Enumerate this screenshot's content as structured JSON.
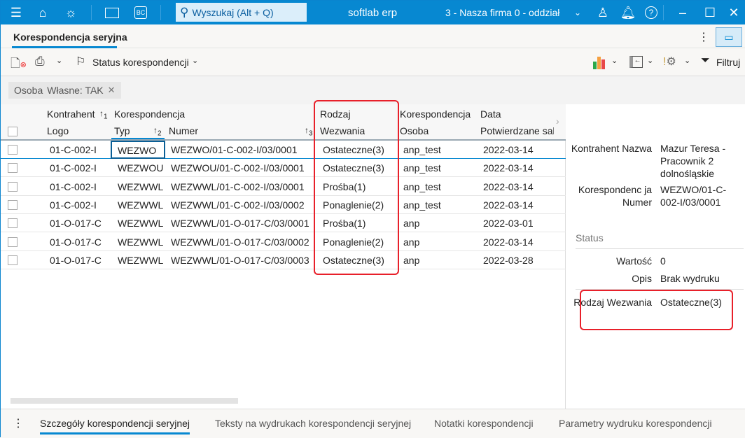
{
  "topbar": {
    "search_placeholder": "Wyszukaj (Alt + Q)",
    "app_name": "softlab erp",
    "company": "3 - Nasza firma 0 - oddział",
    "bc_label": "BC"
  },
  "tabs": {
    "main": "Korespondencja seryjna"
  },
  "toolbar": {
    "status_label": "Status korespondencji",
    "filter_label": "Filtruj"
  },
  "filter_chip": {
    "field": "Osoba",
    "value": "Własne: TAK"
  },
  "grid": {
    "group_headers": [
      "Kontrahent",
      "Korespondencja",
      "Rodzaj",
      "Korespondencja",
      "Data"
    ],
    "columns": [
      "Logo",
      "Typ",
      "Numer",
      "Wezwania",
      "Osoba",
      "Potwierdzane sal"
    ],
    "sort_marks": [
      "1",
      "2",
      "3"
    ],
    "rows": [
      [
        "01-C-002-I",
        "WEZWO",
        "WEZWO/01-C-002-I/03/0001",
        "Ostateczne(3)",
        "anp_test",
        "2022-03-14"
      ],
      [
        "01-C-002-I",
        "WEZWOU",
        "WEZWOU/01-C-002-I/03/0001",
        "Ostateczne(3)",
        "anp_test",
        "2022-03-14"
      ],
      [
        "01-C-002-I",
        "WEZWWL",
        "WEZWWL/01-C-002-I/03/0001",
        "Prośba(1)",
        "anp_test",
        "2022-03-14"
      ],
      [
        "01-C-002-I",
        "WEZWWL",
        "WEZWWL/01-C-002-I/03/0002",
        "Ponaglenie(2)",
        "anp_test",
        "2022-03-14"
      ],
      [
        "01-O-017-C",
        "WEZWWL",
        "WEZWWL/01-O-017-C/03/0001",
        "Prośba(1)",
        "anp",
        "2022-03-01"
      ],
      [
        "01-O-017-C",
        "WEZWWL",
        "WEZWWL/01-O-017-C/03/0002",
        "Ponaglenie(2)",
        "anp",
        "2022-03-14"
      ],
      [
        "01-O-017-C",
        "WEZWWL",
        "WEZWWL/01-O-017-C/03/0003",
        "Ostateczne(3)",
        "anp",
        "2022-03-28"
      ]
    ]
  },
  "details": {
    "kontrahent_label": "Kontrahent Nazwa",
    "kontrahent_value": "Mazur Teresa - Pracownik 2 dolnośląskie",
    "numer_label": "Korespondenc ja Numer",
    "numer_value": "WEZWO/01-C-002-I/03/0001",
    "status_header": "Status",
    "wartosc_label": "Wartość",
    "wartosc_value": "0",
    "opis_label": "Opis",
    "opis_value": "Brak wydruku",
    "rodzaj_label": "Rodzaj Wezwania",
    "rodzaj_value": "Ostateczne(3)"
  },
  "bottom_tabs": [
    "Szczegóły korespondencji seryjnej",
    "Teksty na wydrukach korespondencji seryjnej",
    "Notatki korespondencji",
    "Parametry wydruku korespondencji"
  ]
}
